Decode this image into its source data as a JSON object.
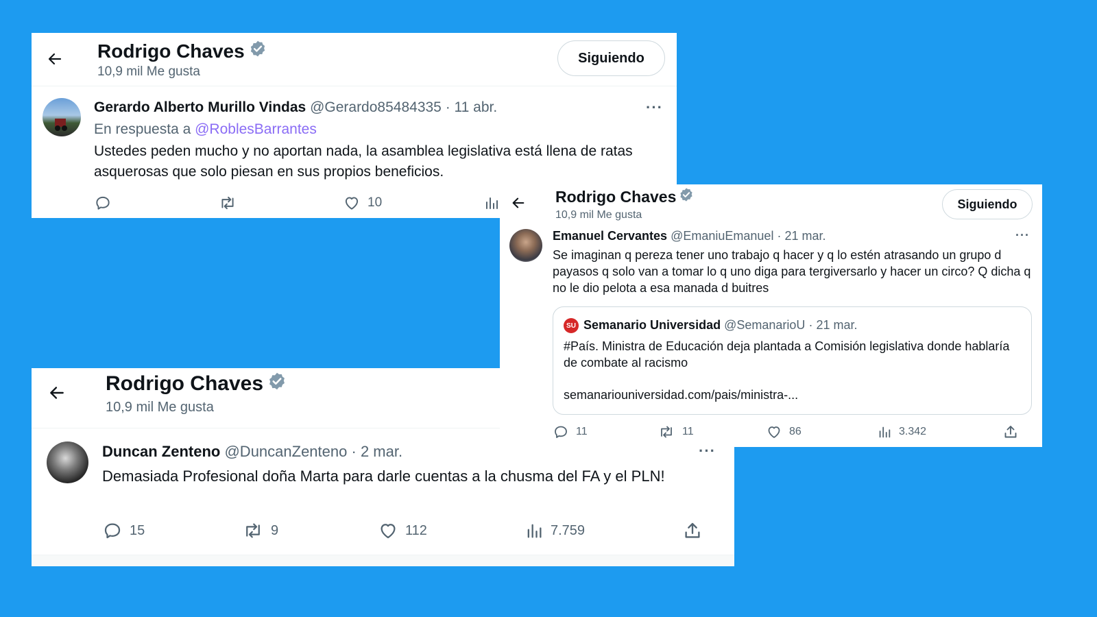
{
  "profile": {
    "name": "Rodrigo Chaves",
    "likes_label": "10,9 mil Me gusta",
    "follow_label": "Siguiendo"
  },
  "tweet1": {
    "name": "Gerardo Alberto Murillo Vindas",
    "handle": "@Gerardo85484335",
    "dot": "·",
    "date": "11 abr.",
    "more": "···",
    "reply_prefix": "En respuesta a",
    "reply_mention": "@RoblesBarrantes",
    "text": "Ustedes peden mucho y no aportan nada, la asamblea legislativa está llena de ratas asquerosas que solo piesan en sus propios beneficios.",
    "likes": "10"
  },
  "tweet2": {
    "name": "Emanuel Cervantes",
    "handle": "@EmaniuEmanuel",
    "dot": "·",
    "date": "21 mar.",
    "more": "···",
    "text": "Se imaginan q pereza tener uno trabajo q hacer y q lo estén atrasando un grupo d payasos q solo van a tomar lo q uno diga para tergiversarlo y hacer un circo? Q dicha q no le dio pelota a esa manada d buitres",
    "quote": {
      "logo_text": "SU",
      "name": "Semanario Universidad",
      "handle": "@SemanarioU",
      "dot": "·",
      "date": "21 mar.",
      "text": "#País. Ministra de Educación deja plantada a Comisión legislativa donde hablaría de combate al racismo",
      "link": "semanariouniversidad.com/pais/ministra-..."
    },
    "replies": "11",
    "retweets": "11",
    "likes": "86",
    "views": "3.342"
  },
  "tweet3": {
    "name": "Duncan Zenteno",
    "handle": "@DuncanZenteno",
    "dot": "·",
    "date": "2 mar.",
    "more": "···",
    "text": "Demasiada Profesional doña Marta para darle cuentas a la chusma del FA y el PLN!",
    "replies": "15",
    "retweets": "9",
    "likes": "112",
    "views": "7.759"
  },
  "colors": {
    "background": "#1d9bf0",
    "verified_badge": "#829aab",
    "mention": "#8a6cf5",
    "secondary_text": "#536471"
  },
  "icons": [
    "back-arrow-icon",
    "verified-badge-icon",
    "reply-icon",
    "retweet-icon",
    "like-icon",
    "views-icon",
    "share-icon",
    "more-icon"
  ]
}
